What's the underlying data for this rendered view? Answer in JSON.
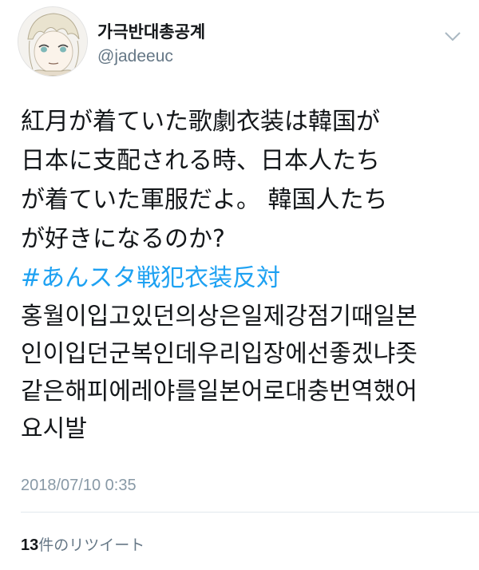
{
  "user": {
    "display_name": "가극반대총공계",
    "handle": "@jadeeuc",
    "avatar_icon": "anime-avatar",
    "menu_icon": "chevron-down-icon"
  },
  "tweet": {
    "lines_ja": [
      "紅月が着ていた歌劇衣装は韓国が",
      "日本に支配される時、日本人たち",
      "が着ていた軍服だよ。 韓国人たち",
      "が好きになるのか?"
    ],
    "hashtag": "#あんスタ戦犯衣装反対",
    "lines_ko": [
      "홍월이입고있던의상은일제강점기때일본",
      "인이입던군복인데우리입장에선좋겠냐좃",
      "같은해피에레야를일본어로대충번역했어",
      "요시발"
    ],
    "timestamp": "2018/07/10 0:35"
  },
  "stats": {
    "retweet_count": "13",
    "retweet_label": "件のリツイート"
  },
  "colors": {
    "hashtag": "#1da1f2",
    "secondary_text": "#657786",
    "timestamp": "#8899a6",
    "divider": "#e1e8ed"
  }
}
